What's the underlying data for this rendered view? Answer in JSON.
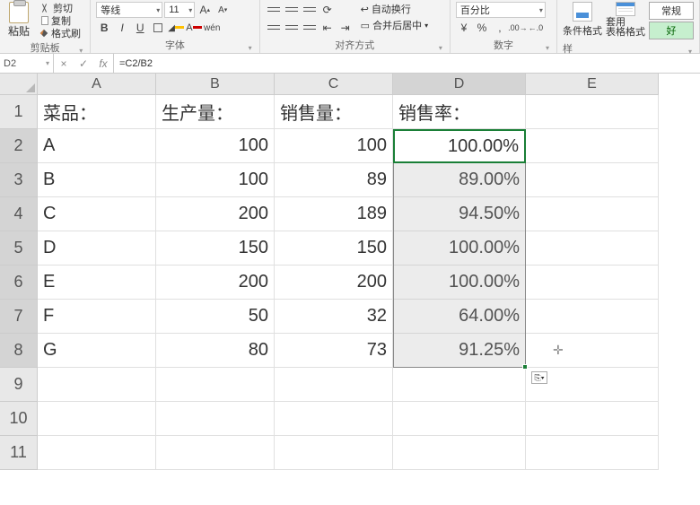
{
  "ribbon": {
    "clipboard": {
      "paste": "粘贴",
      "cut": "剪切",
      "copy": "复制",
      "format_painter": "格式刷",
      "group_label": "剪贴板"
    },
    "font": {
      "font_name": "等线",
      "font_size": "11",
      "increase": "A",
      "decrease": "A",
      "bold": "B",
      "italic": "I",
      "underline": "U",
      "group_label": "字体"
    },
    "alignment": {
      "wrap": "自动换行",
      "merge": "合并后居中",
      "group_label": "对齐方式"
    },
    "number": {
      "format": "百分比",
      "group_label": "数字"
    },
    "styles": {
      "conditional": "条件格式",
      "format_table": "套用\n表格格式",
      "normal": "常规",
      "good": "好",
      "group_label": "样"
    }
  },
  "formula_bar": {
    "name_box": "D2",
    "cancel": "×",
    "enter": "✓",
    "fx": "fx",
    "formula": "=C2/B2"
  },
  "grid": {
    "columns": [
      "A",
      "B",
      "C",
      "D",
      "E"
    ],
    "rows": [
      1,
      2,
      3,
      4,
      5,
      6,
      7,
      8,
      9,
      10,
      11
    ],
    "selected_col_idx": 3,
    "selected_row_start": 1,
    "selected_row_end": 7,
    "headers": {
      "A": "菜品：",
      "B": "生产量：",
      "C": "销售量：",
      "D": "销售率："
    },
    "data": [
      {
        "A": "A",
        "B": "100",
        "C": "100",
        "D": "100.00%"
      },
      {
        "A": "B",
        "B": "100",
        "C": "89",
        "D": "89.00%"
      },
      {
        "A": "C",
        "B": "200",
        "C": "189",
        "D": "94.50%"
      },
      {
        "A": "D",
        "B": "150",
        "C": "150",
        "D": "100.00%"
      },
      {
        "A": "E",
        "B": "200",
        "C": "200",
        "D": "100.00%"
      },
      {
        "A": "F",
        "B": "50",
        "C": "32",
        "D": "64.00%"
      },
      {
        "A": "G",
        "B": "80",
        "C": "73",
        "D": "91.25%"
      }
    ],
    "active_cell_value": "100.00%",
    "paste_options": "⎘▾",
    "cursor_glyph": "✛"
  }
}
